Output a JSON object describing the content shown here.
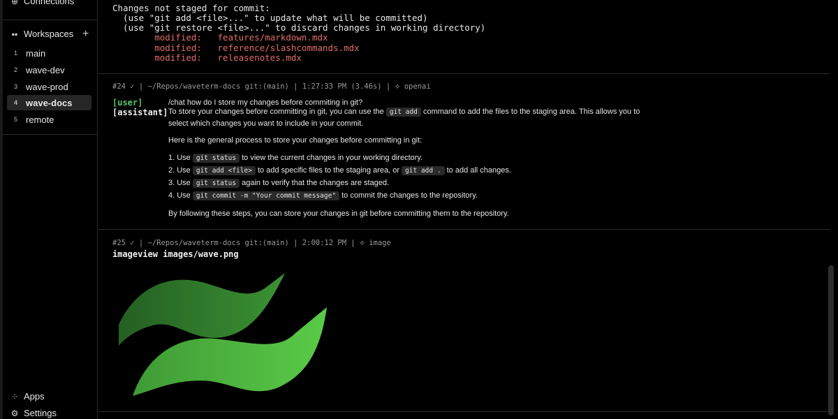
{
  "sidebar": {
    "connections_label": "Connections",
    "workspaces_label": "Workspaces",
    "add_label": "+",
    "workspaces": [
      {
        "num": "1",
        "name": "main"
      },
      {
        "num": "2",
        "name": "wave-dev"
      },
      {
        "num": "3",
        "name": "wave-prod"
      },
      {
        "num": "4",
        "name": "wave-docs"
      },
      {
        "num": "5",
        "name": "remote"
      }
    ],
    "apps_label": "Apps",
    "settings_label": "Settings"
  },
  "block1": {
    "l1": "Changes not staged for commit:",
    "l2": "  (use \"git add <file>...\" to update what will be committed)",
    "l3": "  (use \"git restore <file>...\" to discard changes in working directory)",
    "modified": [
      {
        "label": "        modified:   ",
        "file": "features/markdown.mdx"
      },
      {
        "label": "        modified:   ",
        "file": "reference/slashcommands.mdx"
      },
      {
        "label": "        modified:   ",
        "file": "releasenotes.mdx"
      }
    ]
  },
  "block24": {
    "meta": "#24 ✓ | ~/Repos/waveterm-docs git:(main) | 1:27:33 PM (3.46s) | ⟡ openai",
    "user_tag": "[user]",
    "user_msg": "/chat how do I store my changes before commiting in git?",
    "assistant_tag": "[assistant]",
    "a_p1_a": "To store your changes before committing in git, you can use the ",
    "a_p1_code": "git add",
    "a_p1_b": " command to add the files to the staging area. This allows you to",
    "a_p1_c": "select which changes you want to include in your commit.",
    "a_p2": "Here is the general process to store your changes before committing in git:",
    "steps": [
      {
        "pre": "1. Use ",
        "code": "git status",
        "post": " to view the current changes in your working directory."
      },
      {
        "pre": "2. Use ",
        "code": "git add <file>",
        "post": " to add specific files to the staging area, or ",
        "code2": "git add .",
        "post2": " to add all changes."
      },
      {
        "pre": "3. Use ",
        "code": "git status",
        "post": " again to verify that the changes are staged."
      },
      {
        "pre": "4. Use ",
        "code": "git commit -m \"Your commit message\"",
        "post": " to commit the changes to the repository."
      }
    ],
    "a_p3": "By following these steps, you can store your changes in git before committing them to the repository."
  },
  "block25": {
    "meta": "#25 ✓ | ~/Repos/waveterm-docs git:(main) | 2:00:12 PM | ⟡ image",
    "cmd": "imageview images/wave.png"
  },
  "colors": {
    "accent_green": "#5bc66b",
    "modified_red": "#e06c6c",
    "wave_dark": "#2f7d2c",
    "wave_light": "#58c445"
  }
}
